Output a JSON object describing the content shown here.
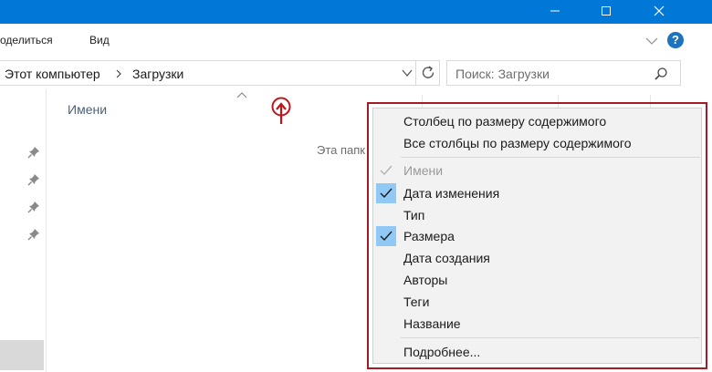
{
  "ribbon": {
    "share_tab": "оделиться",
    "view_tab": "Вид"
  },
  "address": {
    "crumbs": [
      "Этот компьютер",
      "Загрузки"
    ]
  },
  "search": {
    "placeholder": "Поиск: Загрузки"
  },
  "content": {
    "column_name_header": "Имени",
    "empty_message": "Эта папк"
  },
  "context_menu": {
    "items": [
      {
        "label": "Столбец по размеру содержимого",
        "checked": false,
        "enabled": true
      },
      {
        "label": "Все столбцы по размеру содержимого",
        "checked": false,
        "enabled": true
      },
      {
        "label": "Имени",
        "checked": true,
        "enabled": false
      },
      {
        "label": "Дата изменения",
        "checked": true,
        "enabled": true
      },
      {
        "label": "Тип",
        "checked": false,
        "enabled": true
      },
      {
        "label": "Размера",
        "checked": true,
        "enabled": true
      },
      {
        "label": "Дата создания",
        "checked": false,
        "enabled": true
      },
      {
        "label": "Авторы",
        "checked": false,
        "enabled": true
      },
      {
        "label": "Теги",
        "checked": false,
        "enabled": true
      },
      {
        "label": "Название",
        "checked": false,
        "enabled": true
      },
      {
        "label": "Подробнее...",
        "checked": false,
        "enabled": true
      }
    ]
  },
  "colors": {
    "titlebar": "#0078d7",
    "menu_background": "#f2f2f2",
    "check_highlight": "#90c8f6",
    "highlight_frame": "#a31b24",
    "cursor_mark": "#c0141c"
  },
  "icons": [
    "minimize-icon",
    "maximize-icon",
    "close-icon",
    "chevron-down-icon",
    "help-icon",
    "breadcrumb-separator-icon",
    "refresh-icon",
    "search-icon",
    "pin-icon",
    "check-icon",
    "sort-up-icon"
  ]
}
